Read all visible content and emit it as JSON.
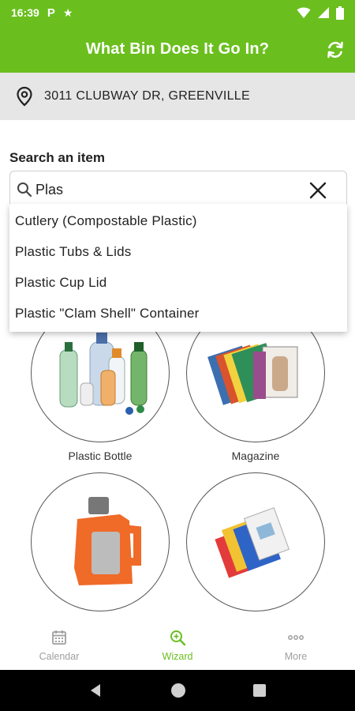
{
  "status_bar": {
    "time": "16:39",
    "p_label": "P"
  },
  "app_bar": {
    "title": "What Bin Does It Go In?"
  },
  "address": {
    "text": "3011 CLUBWAY DR, GREENVILLE"
  },
  "search": {
    "label": "Search an item",
    "value": "Plas",
    "suggestions": [
      "Cutlery (Compostable Plastic)",
      "Plastic Tubs & Lids",
      "Plastic Cup Lid",
      "Plastic \"Clam Shell\" Container"
    ]
  },
  "items": [
    {
      "label": "Plastic Bottle"
    },
    {
      "label": "Magazine"
    },
    {
      "label": ""
    },
    {
      "label": ""
    }
  ],
  "bottom_nav": [
    {
      "label": "Calendar",
      "icon": "calendar-icon"
    },
    {
      "label": "Wizard",
      "icon": "wizard-search-icon",
      "active": true
    },
    {
      "label": "More",
      "icon": "more-dots-icon"
    }
  ],
  "colors": {
    "brand_green": "#6abf1e",
    "address_bg": "#e6e6e6",
    "nav_inactive": "#9e9e9e"
  }
}
